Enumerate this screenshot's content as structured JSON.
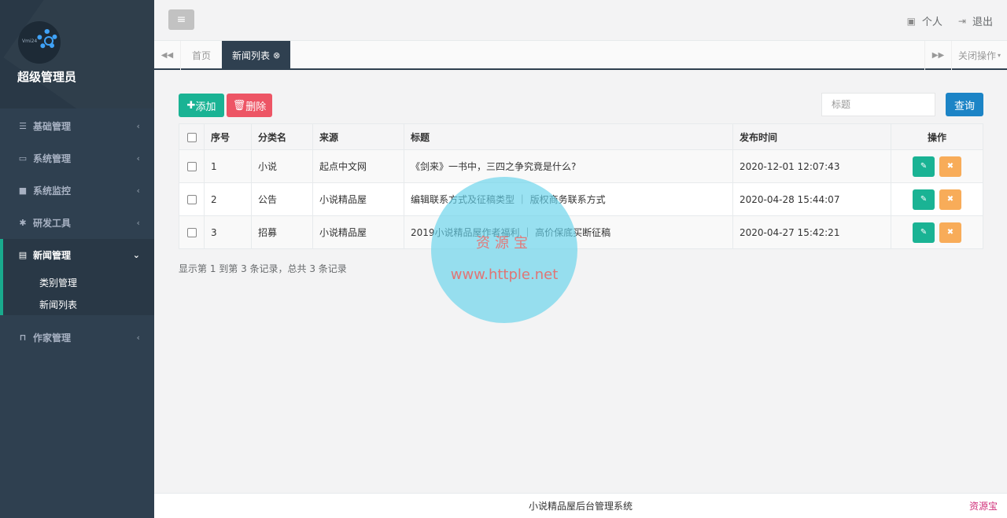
{
  "sidebar": {
    "admin_name": "超级管理员",
    "logo_text": "Vmi24k",
    "items": [
      {
        "label": "基础管理",
        "icon": "list-icon"
      },
      {
        "label": "系统管理",
        "icon": "monitor-icon"
      },
      {
        "label": "系统监控",
        "icon": "video-icon"
      },
      {
        "label": "研发工具",
        "icon": "gear-icon"
      },
      {
        "label": "新闻管理",
        "icon": "newspaper-icon"
      },
      {
        "label": "作家管理",
        "icon": "lock-icon"
      }
    ],
    "news_sub": [
      "类别管理",
      "新闻列表"
    ]
  },
  "topbar": {
    "personal": "个人",
    "logout": "退出"
  },
  "tabs": {
    "home": "首页",
    "active": "新闻列表",
    "close_ops": "关闭操作"
  },
  "toolbar": {
    "add": "添加",
    "delete": "删除",
    "search_placeholder": "标题",
    "query": "查询"
  },
  "table": {
    "headers": [
      "序号",
      "分类名",
      "来源",
      "标题",
      "发布时间",
      "操作"
    ],
    "rows": [
      {
        "no": "1",
        "category": "小说",
        "source": "起点中文网",
        "title": "《剑来》一书中，三四之争究竟是什么?",
        "time": "2020-12-01 12:07:43"
      },
      {
        "no": "2",
        "category": "公告",
        "source": "小说精品屋",
        "title": "编辑联系方式及征稿类型 ｜ 版权商务联系方式",
        "time": "2020-04-28 15:44:07"
      },
      {
        "no": "3",
        "category": "招募",
        "source": "小说精品屋",
        "title": "2019小说精品屋作者福利 ｜ 高价保底买断征稿",
        "time": "2020-04-27 15:42:21"
      }
    ]
  },
  "pagination_info": "显示第 1 到第 3 条记录，总共 3 条记录",
  "watermark": {
    "cn": "资源宝",
    "url": "www.httple.net"
  },
  "footer": {
    "text": "小说精品屋后台管理系统",
    "brand": "资源宝"
  },
  "colors": {
    "sidebar_bg": "#2f4050",
    "primary": "#1ab394",
    "danger": "#ed5565",
    "info": "#1c84c6",
    "warning": "#f8ac59"
  }
}
